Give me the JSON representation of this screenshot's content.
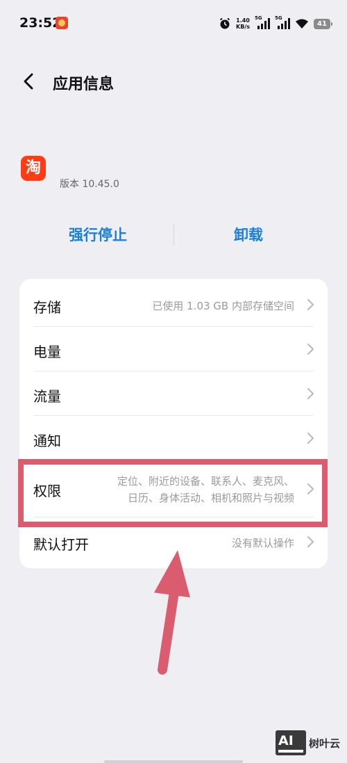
{
  "status_bar": {
    "time": "23:52",
    "net_speed_value": "1.40",
    "net_speed_unit": "KB/s",
    "sim1_label": "5G",
    "sim2_label": "5G",
    "battery_level": "41"
  },
  "header": {
    "title": "应用信息"
  },
  "app": {
    "icon_glyph": "淘",
    "version": "版本 10.45.0"
  },
  "actions": {
    "force_stop": "强行停止",
    "uninstall": "卸载"
  },
  "settings": [
    {
      "label": "存储",
      "value": "已使用 1.03 GB 内部存储空间"
    },
    {
      "label": "电量",
      "value": ""
    },
    {
      "label": "流量",
      "value": ""
    },
    {
      "label": "通知",
      "value": ""
    },
    {
      "label": "权限",
      "value_line1": "定位、附近的设备、联系人、麦克风、",
      "value_line2": "日历、身体活动、相机和照片与视频"
    },
    {
      "label": "默认打开",
      "value": "没有默认操作"
    }
  ],
  "watermark": {
    "badge": "AI",
    "text": "树叶云"
  },
  "colors": {
    "accent": "#1a7fd6",
    "app_icon": "#ff3c14",
    "annotation": "#d95d6e",
    "background": "#eeeef3"
  }
}
